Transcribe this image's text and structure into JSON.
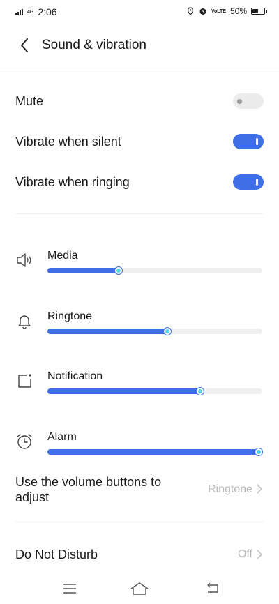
{
  "status_bar": {
    "network": "4G",
    "time": "2:06",
    "volte": "VoLTE",
    "battery_text": "50%",
    "battery_level": 0.5
  },
  "header": {
    "title": "Sound & vibration"
  },
  "toggles": [
    {
      "label": "Mute",
      "state": "off"
    },
    {
      "label": "Vibrate when silent",
      "state": "on"
    },
    {
      "label": "Vibrate when ringing",
      "state": "on"
    }
  ],
  "volumes": [
    {
      "label": "Media",
      "icon": "speaker-icon",
      "level": 0.33
    },
    {
      "label": "Ringtone",
      "icon": "bell-icon",
      "level": 0.56
    },
    {
      "label": "Notification",
      "icon": "notification-icon",
      "level": 0.71
    },
    {
      "label": "Alarm",
      "icon": "alarm-clock-icon",
      "level": 1.0
    }
  ],
  "volume_buttons": {
    "label": "Use the volume buttons to adjust",
    "value": "Ringtone"
  },
  "do_not_disturb": {
    "label": "Do Not Disturb",
    "value": "Off"
  },
  "colors": {
    "accent": "#3f6fe8",
    "thumb": "#5bd6e8",
    "value_text": "#b8b8b8"
  },
  "navbar": {
    "icons": [
      "menu-icon",
      "home-icon",
      "back-nav-icon"
    ]
  }
}
